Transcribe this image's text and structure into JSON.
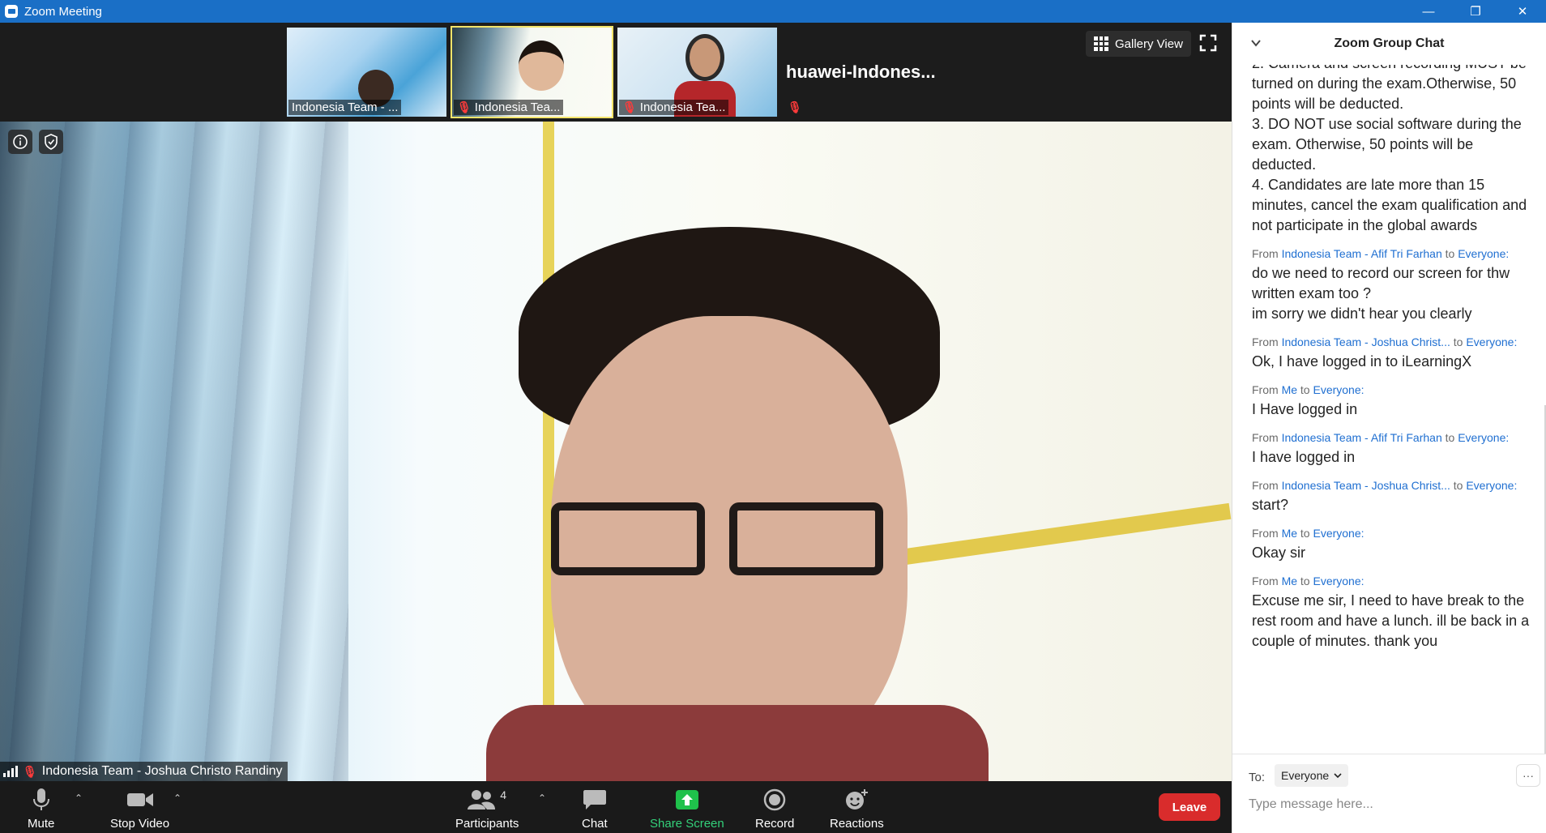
{
  "window": {
    "title": "Zoom Meeting",
    "minimize": "—",
    "restore": "❐",
    "close": "✕"
  },
  "thumbnails": [
    {
      "label": "Indonesia Team - ...",
      "muted": false,
      "active": false
    },
    {
      "label": "Indonesia Tea...",
      "muted": true,
      "active": true
    },
    {
      "label": "Indonesia Tea...",
      "muted": true,
      "active": false
    }
  ],
  "name_tile": {
    "name": "huawei-Indones...",
    "muted": true
  },
  "gallery_view": {
    "label": "Gallery View"
  },
  "main_video": {
    "speaker_name": "Indonesia Team - Joshua Christo Randiny"
  },
  "toolbar": {
    "mute": "Mute",
    "stop_video": "Stop Video",
    "participants": "Participants",
    "participants_count": "4",
    "chat": "Chat",
    "share_screen": "Share Screen",
    "record": "Record",
    "reactions": "Reactions",
    "leave": "Leave"
  },
  "chat": {
    "title": "Zoom Group Chat",
    "continued_text": "2. Camera and screen recording MUST be turned on during the exam.Otherwise, 50 points will be deducted.\n3. DO NOT use social software during the exam. Otherwise, 50 points will be deducted.\n4. Candidates are late more than 15 minutes, cancel the exam qualification and not participate in the global awards",
    "messages": [
      {
        "from": "From",
        "sender": "Indonesia Team - Afif Tri Farhan",
        "to_word": "to",
        "recipient": "Everyone:",
        "text": "do we need to record our screen for thw written exam too ?\nim sorry we didn't hear you clearly"
      },
      {
        "from": "From",
        "sender": "Indonesia Team - Joshua Christ...",
        "to_word": "to",
        "recipient": "Everyone:",
        "text": "Ok, I have logged in to iLearningX"
      },
      {
        "from": "From",
        "sender": "Me",
        "to_word": "to",
        "recipient": "Everyone:",
        "text": "I Have logged in"
      },
      {
        "from": "From",
        "sender": "Indonesia Team - Afif Tri Farhan",
        "to_word": "to",
        "recipient": "Everyone:",
        "text": "I have logged in"
      },
      {
        "from": "From",
        "sender": "Indonesia Team - Joshua Christ...",
        "to_word": "to",
        "recipient": "Everyone:",
        "text": "start?"
      },
      {
        "from": "From",
        "sender": "Me",
        "to_word": "to",
        "recipient": "Everyone:",
        "text": "Okay sir"
      },
      {
        "from": "From",
        "sender": "Me",
        "to_word": "to",
        "recipient": "Everyone:",
        "text": "Excuse me sir, I need to have break to the rest room and have a lunch. ill be back in a couple of minutes. thank you"
      }
    ],
    "to_label": "To:",
    "recipient_select": "Everyone",
    "more": "···",
    "input_placeholder": "Type message here..."
  }
}
